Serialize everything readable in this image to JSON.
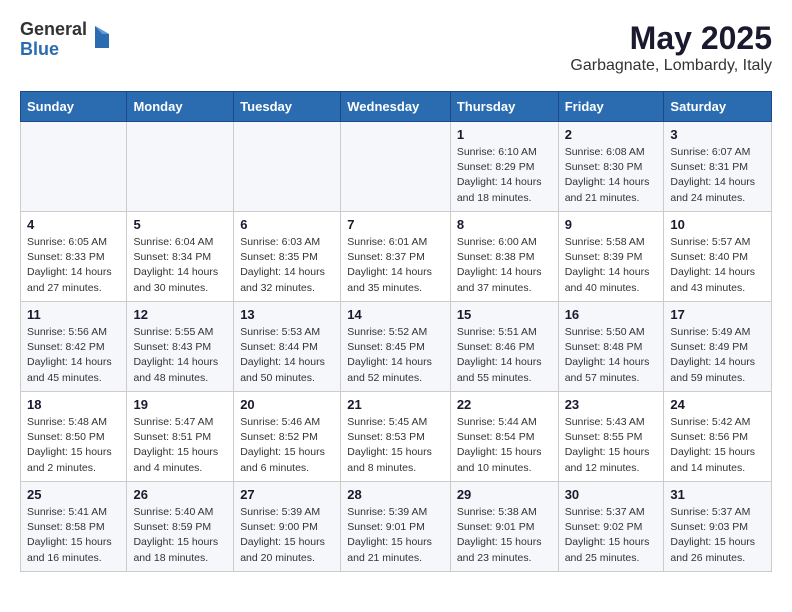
{
  "header": {
    "logo_general": "General",
    "logo_blue": "Blue",
    "title": "May 2025",
    "location": "Garbagnate, Lombardy, Italy"
  },
  "weekdays": [
    "Sunday",
    "Monday",
    "Tuesday",
    "Wednesday",
    "Thursday",
    "Friday",
    "Saturday"
  ],
  "weeks": [
    [
      {
        "day": "",
        "info": ""
      },
      {
        "day": "",
        "info": ""
      },
      {
        "day": "",
        "info": ""
      },
      {
        "day": "",
        "info": ""
      },
      {
        "day": "1",
        "info": "Sunrise: 6:10 AM\nSunset: 8:29 PM\nDaylight: 14 hours\nand 18 minutes."
      },
      {
        "day": "2",
        "info": "Sunrise: 6:08 AM\nSunset: 8:30 PM\nDaylight: 14 hours\nand 21 minutes."
      },
      {
        "day": "3",
        "info": "Sunrise: 6:07 AM\nSunset: 8:31 PM\nDaylight: 14 hours\nand 24 minutes."
      }
    ],
    [
      {
        "day": "4",
        "info": "Sunrise: 6:05 AM\nSunset: 8:33 PM\nDaylight: 14 hours\nand 27 minutes."
      },
      {
        "day": "5",
        "info": "Sunrise: 6:04 AM\nSunset: 8:34 PM\nDaylight: 14 hours\nand 30 minutes."
      },
      {
        "day": "6",
        "info": "Sunrise: 6:03 AM\nSunset: 8:35 PM\nDaylight: 14 hours\nand 32 minutes."
      },
      {
        "day": "7",
        "info": "Sunrise: 6:01 AM\nSunset: 8:37 PM\nDaylight: 14 hours\nand 35 minutes."
      },
      {
        "day": "8",
        "info": "Sunrise: 6:00 AM\nSunset: 8:38 PM\nDaylight: 14 hours\nand 37 minutes."
      },
      {
        "day": "9",
        "info": "Sunrise: 5:58 AM\nSunset: 8:39 PM\nDaylight: 14 hours\nand 40 minutes."
      },
      {
        "day": "10",
        "info": "Sunrise: 5:57 AM\nSunset: 8:40 PM\nDaylight: 14 hours\nand 43 minutes."
      }
    ],
    [
      {
        "day": "11",
        "info": "Sunrise: 5:56 AM\nSunset: 8:42 PM\nDaylight: 14 hours\nand 45 minutes."
      },
      {
        "day": "12",
        "info": "Sunrise: 5:55 AM\nSunset: 8:43 PM\nDaylight: 14 hours\nand 48 minutes."
      },
      {
        "day": "13",
        "info": "Sunrise: 5:53 AM\nSunset: 8:44 PM\nDaylight: 14 hours\nand 50 minutes."
      },
      {
        "day": "14",
        "info": "Sunrise: 5:52 AM\nSunset: 8:45 PM\nDaylight: 14 hours\nand 52 minutes."
      },
      {
        "day": "15",
        "info": "Sunrise: 5:51 AM\nSunset: 8:46 PM\nDaylight: 14 hours\nand 55 minutes."
      },
      {
        "day": "16",
        "info": "Sunrise: 5:50 AM\nSunset: 8:48 PM\nDaylight: 14 hours\nand 57 minutes."
      },
      {
        "day": "17",
        "info": "Sunrise: 5:49 AM\nSunset: 8:49 PM\nDaylight: 14 hours\nand 59 minutes."
      }
    ],
    [
      {
        "day": "18",
        "info": "Sunrise: 5:48 AM\nSunset: 8:50 PM\nDaylight: 15 hours\nand 2 minutes."
      },
      {
        "day": "19",
        "info": "Sunrise: 5:47 AM\nSunset: 8:51 PM\nDaylight: 15 hours\nand 4 minutes."
      },
      {
        "day": "20",
        "info": "Sunrise: 5:46 AM\nSunset: 8:52 PM\nDaylight: 15 hours\nand 6 minutes."
      },
      {
        "day": "21",
        "info": "Sunrise: 5:45 AM\nSunset: 8:53 PM\nDaylight: 15 hours\nand 8 minutes."
      },
      {
        "day": "22",
        "info": "Sunrise: 5:44 AM\nSunset: 8:54 PM\nDaylight: 15 hours\nand 10 minutes."
      },
      {
        "day": "23",
        "info": "Sunrise: 5:43 AM\nSunset: 8:55 PM\nDaylight: 15 hours\nand 12 minutes."
      },
      {
        "day": "24",
        "info": "Sunrise: 5:42 AM\nSunset: 8:56 PM\nDaylight: 15 hours\nand 14 minutes."
      }
    ],
    [
      {
        "day": "25",
        "info": "Sunrise: 5:41 AM\nSunset: 8:58 PM\nDaylight: 15 hours\nand 16 minutes."
      },
      {
        "day": "26",
        "info": "Sunrise: 5:40 AM\nSunset: 8:59 PM\nDaylight: 15 hours\nand 18 minutes."
      },
      {
        "day": "27",
        "info": "Sunrise: 5:39 AM\nSunset: 9:00 PM\nDaylight: 15 hours\nand 20 minutes."
      },
      {
        "day": "28",
        "info": "Sunrise: 5:39 AM\nSunset: 9:01 PM\nDaylight: 15 hours\nand 21 minutes."
      },
      {
        "day": "29",
        "info": "Sunrise: 5:38 AM\nSunset: 9:01 PM\nDaylight: 15 hours\nand 23 minutes."
      },
      {
        "day": "30",
        "info": "Sunrise: 5:37 AM\nSunset: 9:02 PM\nDaylight: 15 hours\nand 25 minutes."
      },
      {
        "day": "31",
        "info": "Sunrise: 5:37 AM\nSunset: 9:03 PM\nDaylight: 15 hours\nand 26 minutes."
      }
    ]
  ]
}
